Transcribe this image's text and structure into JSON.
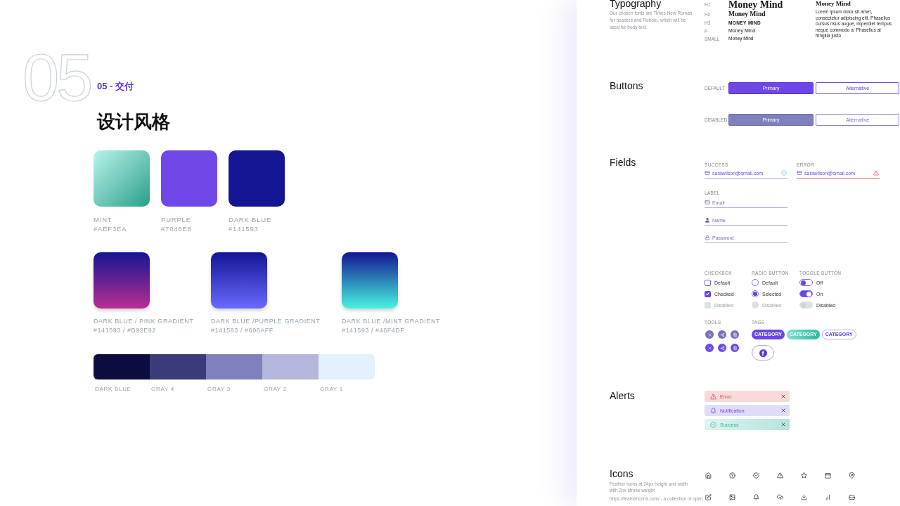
{
  "intro": {
    "watermark": "05",
    "section_label": "05 - 交付",
    "title": "设计风格"
  },
  "swatches": [
    {
      "name": "MINT",
      "code": "#AEF3EA",
      "shaded": true
    },
    {
      "name": "PURPLE",
      "code": "#7048E8",
      "shaded": false
    },
    {
      "name": "DARK BLUE",
      "code": "#141593",
      "shaded": false
    }
  ],
  "gradients": [
    {
      "name": "DARK BLUE / PINK GRADIENT",
      "code": "#141593 / #B92E92"
    },
    {
      "name": "DARK BLUE /PURPLE GRADIENT",
      "code": "#141593 / #696AFF"
    },
    {
      "name": "DARK BLUE /MINT GRADIENT",
      "code": "#141593 / #46F4DF"
    }
  ],
  "palette": [
    {
      "name": "DARK BLUE",
      "color": "#0c0c40"
    },
    {
      "name": "GRAY 4",
      "color": "#3b3b7a"
    },
    {
      "name": "GRAY 3",
      "color": "#8080be"
    },
    {
      "name": "GRAY 2",
      "color": "#b5b6dc"
    },
    {
      "name": "GRAY 1",
      "color": "#e3f0fd"
    }
  ],
  "typography": {
    "title": "Typography",
    "description": "Our chosen fonts are Times New Roman for headers and Roboto, which will be used for body text.",
    "scale": [
      {
        "tag": "H1",
        "sample": "Money Mind",
        "kind": "h1"
      },
      {
        "tag": "H2",
        "sample": "Money Mind",
        "kind": "h2"
      },
      {
        "tag": "H3",
        "sample": "MONEY MIND",
        "kind": "h3"
      },
      {
        "tag": "P",
        "sample": "Money Mind",
        "kind": "p"
      },
      {
        "tag": "SMALL",
        "sample": "Money Mind",
        "kind": "small"
      }
    ],
    "sample_heading": "Money Mind",
    "sample_body": "Lorem ipsum dolor sit amet, consectetur adipiscing elit. Phasellus cursus risus augue, imperdiet tempus neque commodo a. Phasellus at fringilla justo."
  },
  "buttons": {
    "title": "Buttons",
    "rows": [
      {
        "label": "DEFAULT",
        "disabled": false,
        "items": [
          {
            "text": "Primary",
            "kind": "primary"
          },
          {
            "text": "Alternative",
            "kind": "alternative"
          }
        ]
      },
      {
        "label": "DISABLED",
        "disabled": true,
        "items": [
          {
            "text": "Primary",
            "kind": "primary"
          },
          {
            "text": "Alternative",
            "kind": "alternative"
          }
        ]
      }
    ]
  },
  "fields": {
    "title": "Fields",
    "status_fields": [
      {
        "label": "SUCCESS",
        "value": "sarawilson@gmail.com",
        "error": false
      },
      {
        "label": "ERROR",
        "value": "sarawilson@gmail.com",
        "error": true
      }
    ],
    "label": "LABEL",
    "items": [
      {
        "kind": "email",
        "placeholder": "Email"
      },
      {
        "kind": "name",
        "placeholder": "Name"
      },
      {
        "kind": "password",
        "placeholder": "Password"
      }
    ]
  },
  "controls": {
    "checkboxes": {
      "label": "CHECKBOX",
      "items": [
        {
          "label": "Default",
          "checked": false,
          "disabled": false
        },
        {
          "label": "Checked",
          "checked": true,
          "disabled": false
        },
        {
          "label": "Disabled",
          "checked": false,
          "disabled": true
        }
      ]
    },
    "radios": {
      "label": "RADIO BUTTON",
      "items": [
        {
          "label": "Default",
          "selected": false,
          "disabled": false
        },
        {
          "label": "Selected",
          "selected": true,
          "disabled": false
        },
        {
          "label": "Disabled",
          "selected": false,
          "disabled": true
        }
      ]
    },
    "toggles": {
      "label": "TOGGLE BUTTON",
      "items": [
        {
          "label": "Off",
          "on": false,
          "disabled": false
        },
        {
          "label": "On",
          "on": true,
          "disabled": false
        },
        {
          "label": "Disabled",
          "on": false,
          "disabled": true
        }
      ]
    },
    "tools": {
      "label": "TOOLS",
      "rows": [
        {
          "disabled": true
        },
        {
          "disabled": false
        }
      ]
    },
    "tags": {
      "label": "TAGS",
      "items": [
        {
          "text": "CATEGORY",
          "kind": "filled"
        },
        {
          "text": "CATEGORY",
          "kind": "mint"
        },
        {
          "text": "CATEGORY",
          "kind": "outline"
        }
      ],
      "social_button": "f"
    }
  },
  "alerts": {
    "title": "Alerts",
    "items": [
      {
        "kind": "error",
        "text": "Error:"
      },
      {
        "kind": "notification",
        "text": "Notification"
      },
      {
        "kind": "success",
        "text": "Success"
      }
    ]
  },
  "icons_section": {
    "title": "Icons",
    "description": "Feather icons at 24px height and width with 2px stroke weight",
    "link": "https://feathericons.com/ - a collection of open"
  }
}
